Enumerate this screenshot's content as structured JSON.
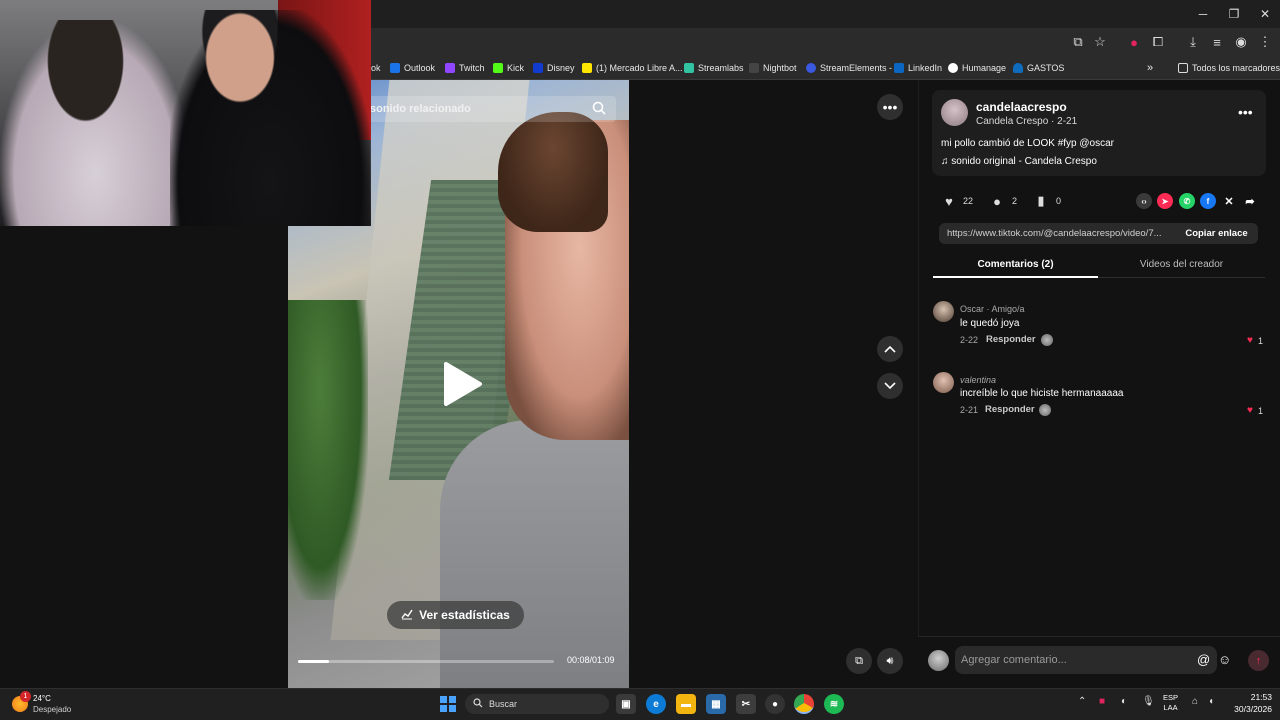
{
  "browser": {
    "bookmarks": [
      "ok",
      "Outlook",
      "Twitch",
      "Kick",
      "Disney",
      "(1) Mercado Libre A...",
      "Streamlabs",
      "Nightbot",
      "StreamElements -",
      "LinkedIn",
      "Humanage",
      "GASTOS"
    ],
    "all_bookmarks": "Todos los marcadores",
    "more_chevron": "»"
  },
  "video": {
    "search_text": "sonido relacionado",
    "stats_button": "Ver estadísticas",
    "time": "00:08/01:09",
    "progress": 0.12
  },
  "post": {
    "username": "candelaacrespo",
    "display_line": "Candela Crespo · 2-21",
    "description": "mi pollo cambió de LOOK #fyp @oscar",
    "sound": "sonido original - Candela Crespo",
    "likes": "22",
    "comments": "2",
    "saves": "0",
    "link": "https://www.tiktok.com/@candelaacrespo/video/7...",
    "copy_label": "Copiar enlace"
  },
  "tabs": {
    "comments": "Comentarios (2)",
    "videos": "Videos del creador"
  },
  "comments": [
    {
      "user": "Oscar · Amigo/a",
      "text": "le quedó joya",
      "date": "2-22",
      "reply": "Responder",
      "likes": "1"
    },
    {
      "user": "valentina",
      "text": "increíble lo que hiciste hermanaaaaa",
      "date": "2-21",
      "reply": "Responder",
      "likes": "1"
    }
  ],
  "comment_input": {
    "placeholder": "Agregar comentario..."
  },
  "taskbar": {
    "temp": "24°C",
    "weather": "Despejado",
    "weather_badge": "1",
    "search": "Buscar",
    "lang_line1": "ESP",
    "lang_line2": "LAA",
    "time": "21:53",
    "date": "30/3/2026"
  },
  "colors": {
    "accent": "#fe2c55",
    "bg": "#121212",
    "card": "#1e1e1e"
  }
}
